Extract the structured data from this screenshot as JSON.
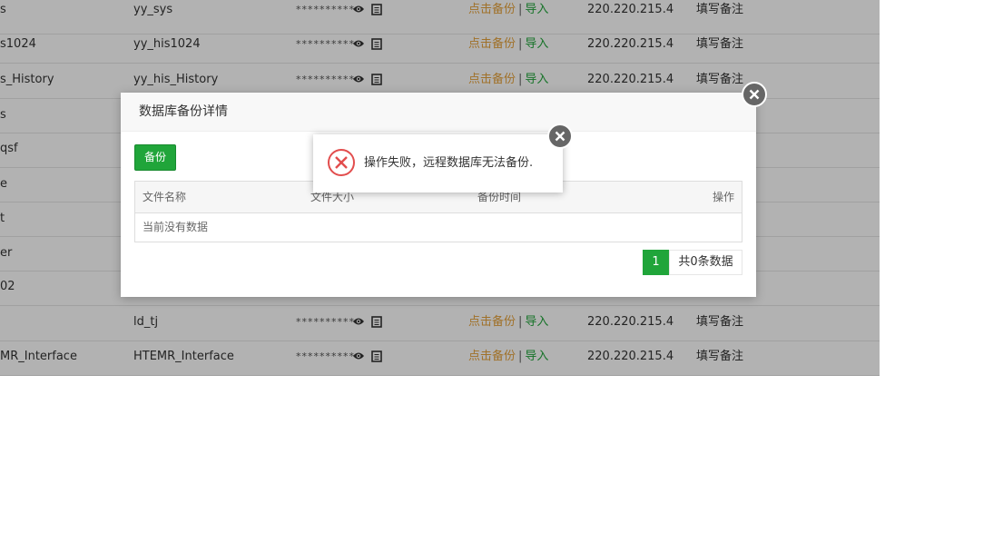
{
  "rows": [
    {
      "name": "s",
      "user": "yy_sys",
      "pwd": "**********",
      "backup": "点击备份",
      "sep": "|",
      "import": "导入",
      "ip": "220.220.215.4",
      "note": "填写备注"
    },
    {
      "name": "s1024",
      "user": "yy_his1024",
      "pwd": "**********",
      "backup": "点击备份",
      "sep": "|",
      "import": "导入",
      "ip": "220.220.215.4",
      "note": "填写备注"
    },
    {
      "name": "s_History",
      "user": "yy_his_History",
      "pwd": "**********",
      "backup": "点击备份",
      "sep": "|",
      "import": "导入",
      "ip": "220.220.215.4",
      "note": "填写备注"
    },
    {
      "name": "s"
    },
    {
      "name": "qsf"
    },
    {
      "name": "e"
    },
    {
      "name": "t"
    },
    {
      "name": "er"
    },
    {
      "name": "02"
    },
    {
      "name": "",
      "user": "ld_tj",
      "pwd": "**********",
      "backup": "点击备份",
      "sep": "|",
      "import": "导入",
      "ip": "220.220.215.4",
      "note": "填写备注"
    },
    {
      "name": "MR_Interface",
      "user": "HTEMR_Interface",
      "pwd": "**********",
      "backup": "点击备份",
      "sep": "|",
      "import": "导入",
      "ip": "220.220.215.4",
      "note": "填写备注"
    }
  ],
  "modal": {
    "title": "数据库备份详情",
    "backup_button": "备份",
    "columns": [
      "文件名称",
      "文件大小",
      "备份时间",
      "操作"
    ],
    "empty_text": "当前没有数据",
    "pager": {
      "current": "1",
      "total": "共0条数据"
    }
  },
  "toast": {
    "message": "操作失败，远程数据库无法备份."
  },
  "colors": {
    "accent_green": "#20a53a",
    "backup_orange": "#e6a23c",
    "error_red": "#e24d4d"
  }
}
